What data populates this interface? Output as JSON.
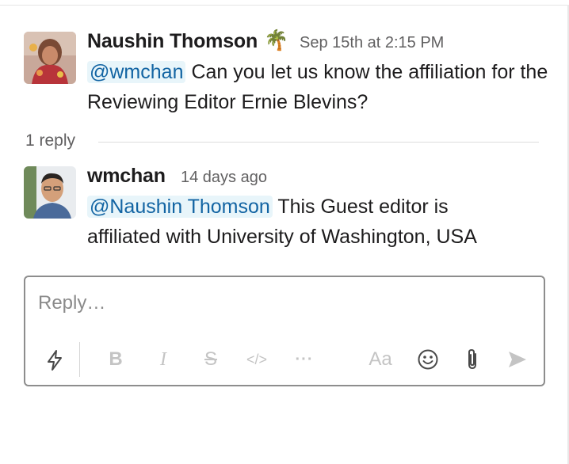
{
  "thread": {
    "parent": {
      "author": "Naushin Thomson",
      "status_emoji": "🌴",
      "timestamp": "Sep 15th at 2:15 PM",
      "mention": "@wmchan",
      "text": "Can you let us know the affiliation for the Reviewing Editor Ernie Blevins?"
    },
    "reply_count": "1 reply",
    "reply": {
      "author": "wmchan",
      "timestamp": "14 days ago",
      "mention": "@Naushin Thomson",
      "text": "This Guest editor is affiliated with University of Washington, USA"
    }
  },
  "composer": {
    "placeholder": "Reply…",
    "toolbar": {
      "shortcuts_icon": "lightning-icon",
      "bold_label": "B",
      "italic_label": "I",
      "strike_label": "S",
      "code_label": "</>",
      "more_label": "···",
      "format_label": "Aa",
      "emoji_icon": "smiley-icon",
      "attach_icon": "paperclip-icon",
      "send_icon": "send-icon"
    }
  },
  "colors": {
    "mention_text": "#1264a3",
    "mention_bg": "#e8f5fa",
    "muted_text": "#616061",
    "composer_border": "#8d8d8d"
  }
}
